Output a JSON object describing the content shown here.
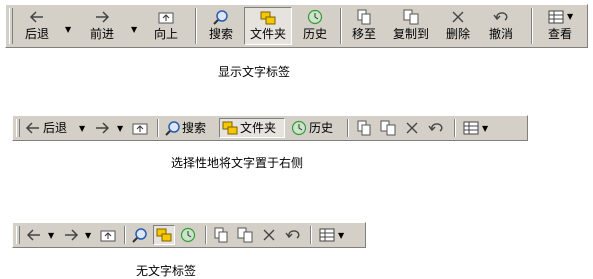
{
  "toolbar1": {
    "back_label": "后退",
    "forward_label": "前进",
    "up_label": "向上",
    "search_label": "搜索",
    "folders_label": "文件夹",
    "history_label": "历史",
    "moveto_label": "移至",
    "copyto_label": "复制到",
    "delete_label": "删除",
    "undo_label": "撤消",
    "views_label": "查看",
    "dropdown_glyph": "▼",
    "caption": "显示文字标签"
  },
  "toolbar2": {
    "back_label": "后退",
    "search_label": "搜索",
    "folders_label": "文件夹",
    "history_label": "历史",
    "dropdown_glyph": "▼",
    "caption": "选择性地将文字置于右侧"
  },
  "toolbar3": {
    "dropdown_glyph": "▼",
    "caption": "无文字标签"
  },
  "icons": {
    "back": "arrow-left-icon",
    "forward": "arrow-right-icon",
    "up": "folder-up-icon",
    "search": "search-icon",
    "folders": "folder-tree-icon",
    "history": "history-icon",
    "moveto": "move-to-icon",
    "copyto": "copy-to-icon",
    "delete": "delete-x-icon",
    "undo": "undo-icon",
    "views": "views-grid-icon"
  },
  "colors": {
    "toolbar_bg": "#d4d0c8",
    "pressed_bg": "#e6e3de",
    "folder_yellow": "#f5c800",
    "search_blue": "#2a5db0",
    "history_green": "#3a9a3a"
  }
}
